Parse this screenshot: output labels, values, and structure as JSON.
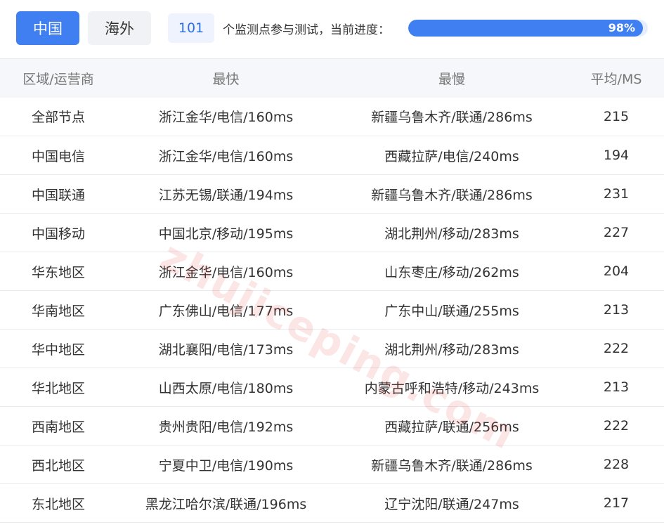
{
  "tabs": {
    "china": "中国",
    "overseas": "海外"
  },
  "progress": {
    "node_count": "101",
    "label": "个监测点参与测试，当前进度：",
    "percent_text": "98%",
    "percent_value": 98
  },
  "table": {
    "headers": {
      "region": "区域/运营商",
      "fastest": "最快",
      "slowest": "最慢",
      "avg": "平均/MS"
    },
    "rows": [
      {
        "region": "全部节点",
        "fastest": "浙江金华/电信/160ms",
        "slowest": "新疆乌鲁木齐/联通/286ms",
        "avg": "215"
      },
      {
        "region": "中国电信",
        "fastest": "浙江金华/电信/160ms",
        "slowest": "西藏拉萨/电信/240ms",
        "avg": "194"
      },
      {
        "region": "中国联通",
        "fastest": "江苏无锡/联通/194ms",
        "slowest": "新疆乌鲁木齐/联通/286ms",
        "avg": "231"
      },
      {
        "region": "中国移动",
        "fastest": "中国北京/移动/195ms",
        "slowest": "湖北荆州/移动/283ms",
        "avg": "227"
      },
      {
        "region": "华东地区",
        "fastest": "浙江金华/电信/160ms",
        "slowest": "山东枣庄/移动/262ms",
        "avg": "204"
      },
      {
        "region": "华南地区",
        "fastest": "广东佛山/电信/177ms",
        "slowest": "广东中山/联通/255ms",
        "avg": "213"
      },
      {
        "region": "华中地区",
        "fastest": "湖北襄阳/电信/173ms",
        "slowest": "湖北荆州/移动/283ms",
        "avg": "222"
      },
      {
        "region": "华北地区",
        "fastest": "山西太原/电信/180ms",
        "slowest": "内蒙古呼和浩特/移动/243ms",
        "avg": "213"
      },
      {
        "region": "西南地区",
        "fastest": "贵州贵阳/电信/192ms",
        "slowest": "西藏拉萨/联通/256ms",
        "avg": "222"
      },
      {
        "region": "西北地区",
        "fastest": "宁夏中卫/电信/190ms",
        "slowest": "新疆乌鲁木齐/联通/286ms",
        "avg": "228"
      },
      {
        "region": "东北地区",
        "fastest": "黑龙江哈尔滨/联通/196ms",
        "slowest": "辽宁沈阳/联通/247ms",
        "avg": "217"
      }
    ]
  },
  "watermark": "zhujiceping.com"
}
